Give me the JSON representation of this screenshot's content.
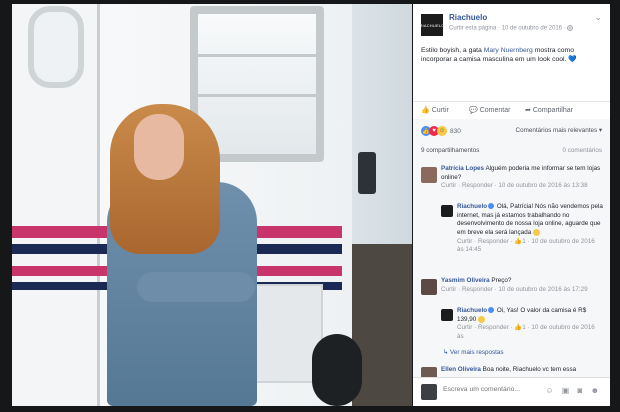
{
  "post": {
    "page_name": "Riachuelo",
    "logo_text": "RIACHUELO",
    "meta": "Curtir esta página · 10 de outubro de 2016 ·",
    "caption_before": "Estilo boyish, a gata ",
    "caption_tag": "Mary Nuernberg",
    "caption_after": " mostra como incorporar a camisa masculina em um look cool. ",
    "caption_heart": "💙",
    "actions": {
      "like": "Curtir",
      "comment": "Comentar",
      "share": "Compartilhar"
    },
    "reactions_count": "830",
    "relevance": "Comentários mais relevantes ▾"
  },
  "comments": {
    "header": "9 compartilhamentos",
    "count_right": "0 comentários",
    "items": [
      {
        "name": "Patrícia Lopes",
        "text": " Alguém poderia me informar se tem lojas online?",
        "meta": "Curtir · Responder · 10 de outubro de 2016 às 13:38"
      },
      {
        "name": "Riachuelo",
        "text": " Olá, Patrícia! Nós não vendemos pela internet, mas já estamos trabalhando no desenvolvimento de nossa loja online, aguarde que em breve ela será lançada ",
        "meta": "Curtir · Responder · ",
        "meta_likes": "1",
        "meta_after": " · 10 de outubro de 2016 às 14:45"
      },
      {
        "name": "Yasmim Oliveira",
        "text": " Preço?",
        "meta": "Curtir · Responder · 10 de outubro de 2016 às 17:29"
      },
      {
        "name": "Riachuelo",
        "text": " Oi, Yas! O valor da camisa é R$ 139,90 ",
        "meta": "Curtir · Responder · ",
        "meta_likes": "1",
        "meta_after": " · 10 de outubro de 2016 às"
      },
      {
        "name": "Ellen Oliveira",
        "text": " Boa noite, Riachuelo vc tem essa"
      }
    ],
    "more_replies": "↳ Ver mais respostas"
  },
  "composer": {
    "placeholder": "Escreva um comentário...",
    "icons": "☺ ▣ ◙ ☻"
  },
  "colors": {
    "link": "#365899",
    "like_blue": "#4d8ef0",
    "love_red": "#f0284a",
    "haha_yellow": "#f7c948"
  }
}
